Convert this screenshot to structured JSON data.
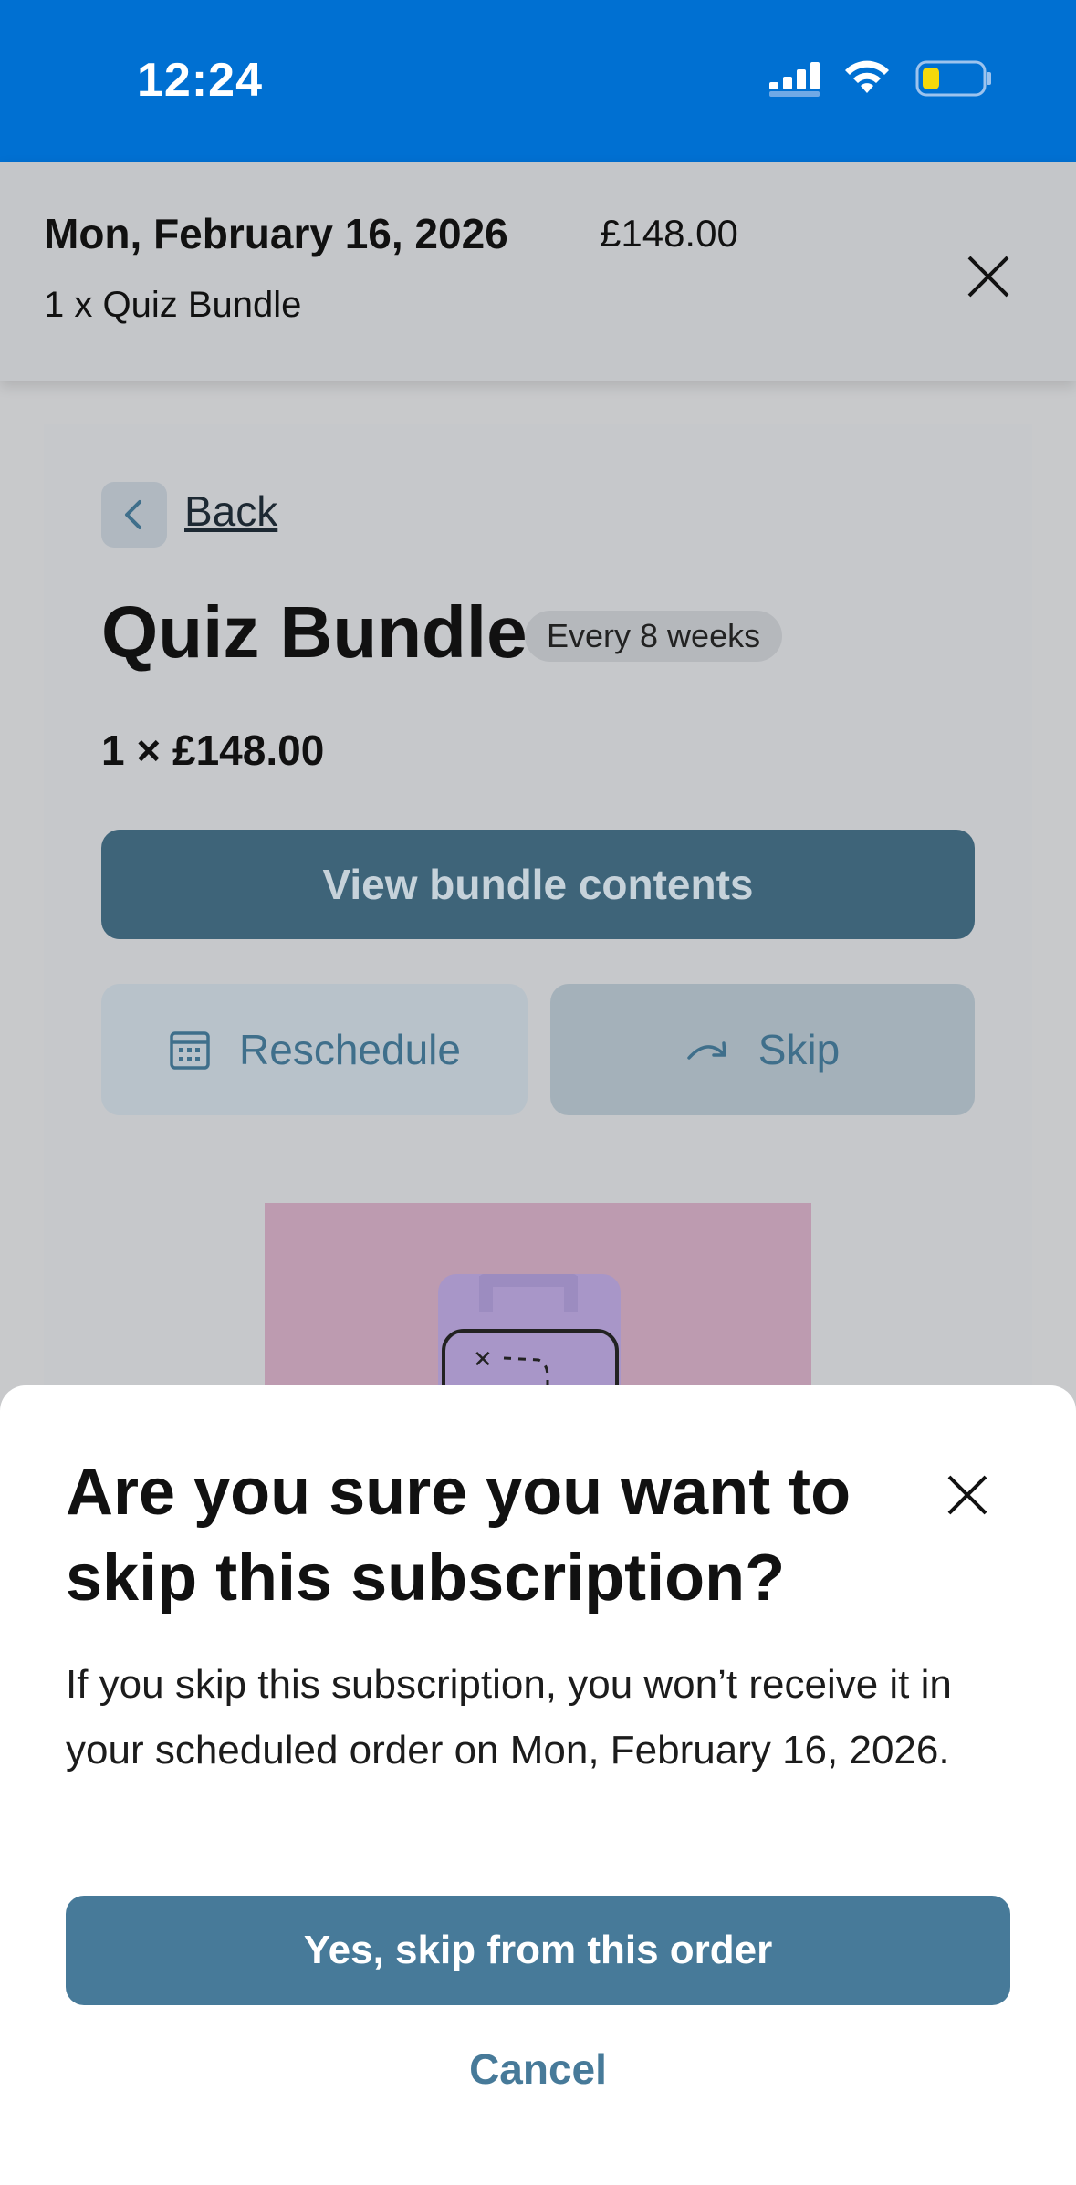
{
  "status_bar": {
    "time": "12:24"
  },
  "order_header": {
    "date": "Mon, February 16, 2026",
    "price": "£148.00",
    "items": "1 x Quiz Bundle"
  },
  "product": {
    "back_label": "Back",
    "title": "Quiz Bundle",
    "frequency": "Every 8 weeks",
    "qty_price": "1 × £148.00",
    "view_contents_label": "View bundle contents",
    "reschedule_label": "Reschedule",
    "skip_label": "Skip"
  },
  "modal": {
    "title": "Are you sure you want to skip this subscription?",
    "body": "If you skip this subscription, you won’t receive it in your scheduled order on Mon, February 16, 2026.",
    "confirm_label": "Yes, skip from this order",
    "cancel_label": "Cancel"
  },
  "colors": {
    "status_bar": "#0070d2",
    "primary_button": "#477a99",
    "overlay_bg": "#c8c9cb"
  },
  "icons": [
    "signal-icon",
    "wifi-icon",
    "battery-icon",
    "close-icon",
    "chevron-left-icon",
    "calendar-icon",
    "skip-arrow-icon"
  ]
}
